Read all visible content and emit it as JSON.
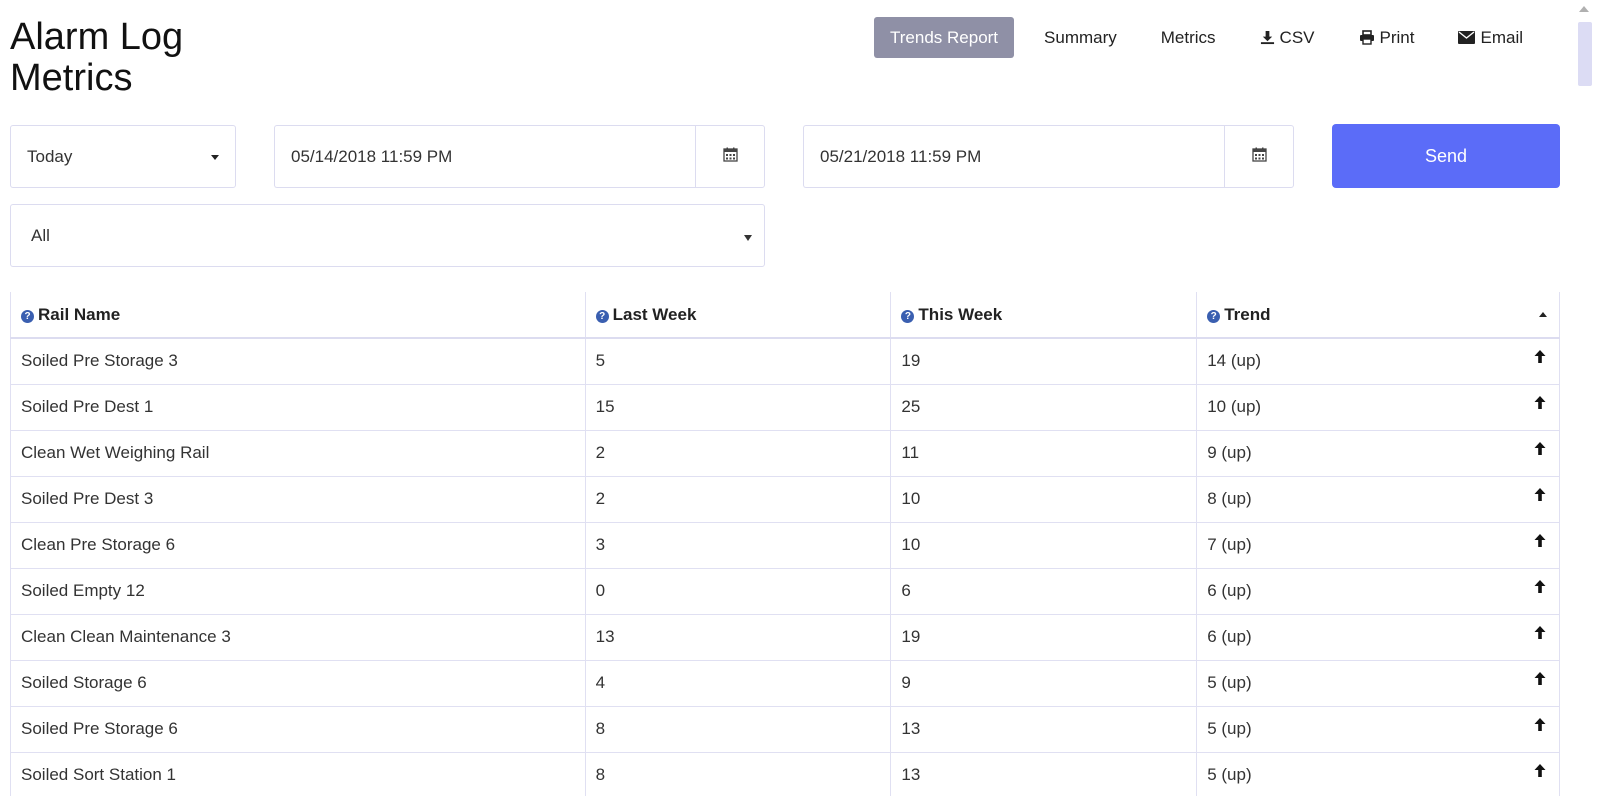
{
  "page": {
    "title_line1": "Alarm Log",
    "title_line2": "Metrics"
  },
  "nav": {
    "trends_report": "Trends Report",
    "summary": "Summary",
    "metrics": "Metrics",
    "csv": "CSV",
    "print": "Print",
    "email": "Email",
    "icons": {
      "csv": "download-icon",
      "print": "print-icon",
      "email": "envelope-icon"
    }
  },
  "filters": {
    "range": "Today",
    "start_date": "05/14/2018 11:59 PM",
    "end_date": "05/21/2018 11:59 PM",
    "send_label": "Send",
    "category": "All"
  },
  "colors": {
    "active_tab": "#8f90a6",
    "send_button": "#5b6cf8",
    "help_icon": "#3a5fb0"
  },
  "table": {
    "headers": [
      "Rail Name",
      "Last Week",
      "This Week",
      "Trend"
    ],
    "rows": [
      [
        "Soiled Pre Storage 3",
        "5",
        "19",
        "14 (up)"
      ],
      [
        "Soiled Pre Dest 1",
        "15",
        "25",
        "10 (up)"
      ],
      [
        "Clean Wet Weighing Rail",
        "2",
        "11",
        "9 (up)"
      ],
      [
        "Soiled Pre Dest 3",
        "2",
        "10",
        "8 (up)"
      ],
      [
        "Clean Pre Storage 6",
        "3",
        "10",
        "7 (up)"
      ],
      [
        "Soiled Empty 12",
        "0",
        "6",
        "6 (up)"
      ],
      [
        "Clean Clean Maintenance 3",
        "13",
        "19",
        "6 (up)"
      ],
      [
        "Soiled Storage 6",
        "4",
        "9",
        "5 (up)"
      ],
      [
        "Soiled Pre Storage 6",
        "8",
        "13",
        "5 (up)"
      ],
      [
        "Soiled Sort Station 1",
        "8",
        "13",
        "5 (up)"
      ]
    ]
  }
}
